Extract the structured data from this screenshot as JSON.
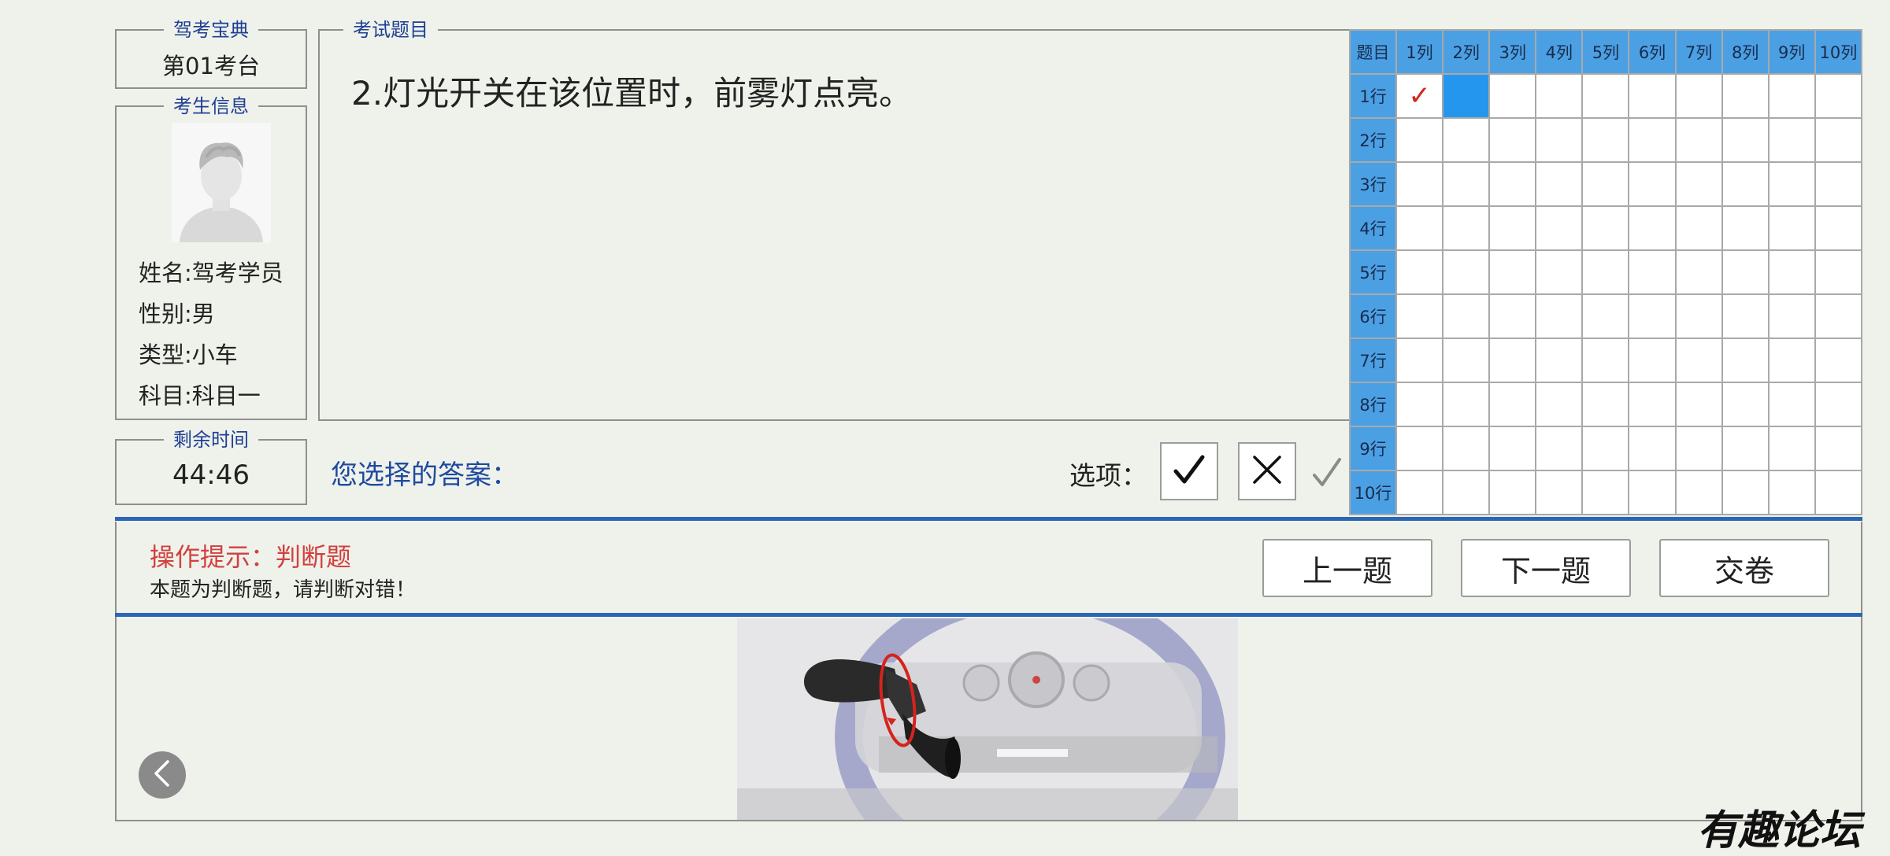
{
  "station": {
    "legend": "驾考宝典",
    "value": "第01考台"
  },
  "examinee": {
    "legend": "考生信息",
    "name": "姓名:驾考学员",
    "gender": "性别:男",
    "type": "类型:小车",
    "subject": "科目一"
  },
  "timer": {
    "legend": "剩余时间",
    "value": "44:46"
  },
  "question": {
    "legend": "考试题目",
    "text": "2.灯光开关在该位置时，前雾灯点亮。"
  },
  "grid": {
    "corner": "题目",
    "columns": [
      "1列",
      "2列",
      "3列",
      "4列",
      "5列",
      "6列",
      "7列",
      "8列",
      "9列",
      "10列"
    ],
    "rows": [
      "1行",
      "2行",
      "3行",
      "4行",
      "5行",
      "6行",
      "7行",
      "8行",
      "9行",
      "10行"
    ],
    "answered_mark": "✓",
    "answered": [
      {
        "row": 1,
        "col": 1
      }
    ],
    "current": {
      "row": 1,
      "col": 2
    }
  },
  "answer": {
    "label": "您选择的答案：",
    "value": ""
  },
  "options": {
    "label": "选项：",
    "true_icon": "check-icon",
    "false_icon": "cross-icon"
  },
  "hint": {
    "title": "操作提示：判断题",
    "body": "本题为判断题，请判断对错！"
  },
  "nav": {
    "prev": "上一题",
    "next": "下一题",
    "submit": "交卷"
  },
  "watermark": "有趣论坛",
  "colors": {
    "accent_blue": "#2a66b5",
    "grid_header": "#4ba0e4",
    "grid_current": "#2596ee",
    "legend_text": "#1f3f95",
    "hint_title": "#d24040",
    "mark": "#d6231c",
    "background": "#eff2ea"
  }
}
